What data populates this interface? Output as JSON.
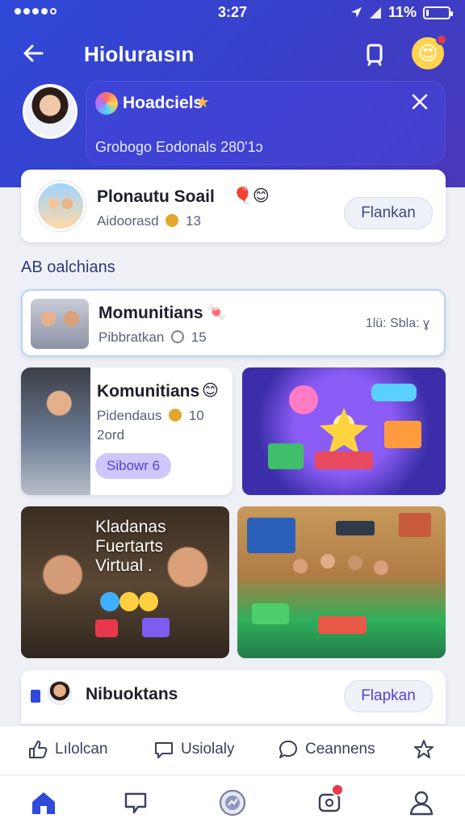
{
  "status_bar": {
    "time": "3:27",
    "battery": "11%",
    "battery_level": 0.11
  },
  "header": {
    "title": "Hioluraısın"
  },
  "highlight": {
    "title": "Hoadciels",
    "meta": "Grobogo  Eodonals  280'1ɔ"
  },
  "feature_card": {
    "title": "Plonautu Soail",
    "meta_label": "Aidoorasd",
    "meta_count": "13",
    "button": "Flankan"
  },
  "section": {
    "label": "AB oalchians"
  },
  "community_card": {
    "title": "Momunitians",
    "meta_label": "Pibbratkan",
    "meta_count": "15",
    "right_meta": "1lü: Sbla: ɣ"
  },
  "tile_community": {
    "title": "Komunitians",
    "meta_label": "Pidendaus",
    "meta_count": "10",
    "meta_line2": "2ord",
    "badge": "Sibowr 6"
  },
  "tile_virtual": {
    "line1": "Kladanas",
    "line2": "Fuertarts",
    "line3": "Virtual ."
  },
  "last_card": {
    "title": "Nibuoktans",
    "button": "Flapkan"
  },
  "actions": [
    {
      "icon": "thumbs-up-icon",
      "label": "Lılolcan"
    },
    {
      "icon": "chat-icon",
      "label": "Usiolaly"
    },
    {
      "icon": "comment-icon",
      "label": "Ceannens"
    },
    {
      "icon": "star-icon",
      "label": ""
    }
  ],
  "bottom_nav": [
    {
      "icon": "home-icon",
      "active": true
    },
    {
      "icon": "message-icon",
      "active": false
    },
    {
      "icon": "explore-icon",
      "active": false
    },
    {
      "icon": "notification-icon",
      "active": false,
      "badge": true
    },
    {
      "icon": "profile-icon",
      "active": false
    }
  ],
  "colors": {
    "brand": "#2f49d8",
    "accent": "#7a5cf0",
    "badge_red": "#e53b4a"
  }
}
